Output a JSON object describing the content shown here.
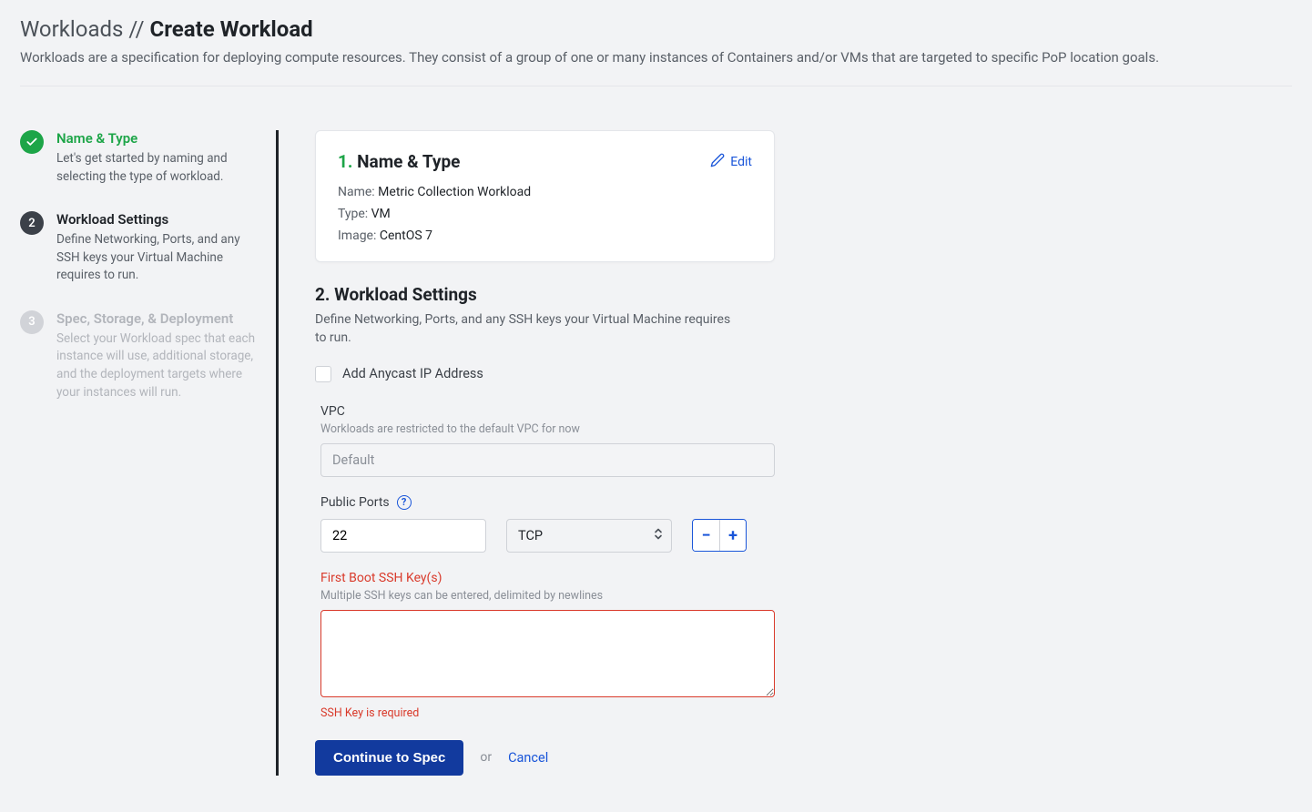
{
  "header": {
    "breadcrumb_prefix": "Workloads // ",
    "title": "Create Workload",
    "description": "Workloads are a specification for deploying compute resources. They consist of a group of one or many instances of Containers and/or VMs that are targeted to specific PoP location goals."
  },
  "sidebar": {
    "steps": [
      {
        "title": "Name & Type",
        "desc": "Let's get started by naming and selecting the type of workload."
      },
      {
        "num": "2",
        "title": "Workload Settings",
        "desc": "Define Networking, Ports, and any SSH keys your Virtual Machine requires to run."
      },
      {
        "num": "3",
        "title": "Spec, Storage, & Deployment",
        "desc": "Select your Workload spec that each instance will use, additional storage, and the deployment targets where your instances will run."
      }
    ]
  },
  "summary": {
    "heading_num": "1. ",
    "heading_text": "Name & Type",
    "edit_label": "Edit",
    "rows": {
      "name_k": "Name: ",
      "name_v": "Metric Collection Workload",
      "type_k": "Type: ",
      "type_v": "VM",
      "image_k": "Image: ",
      "image_v": "CentOS 7"
    }
  },
  "settings": {
    "heading": "2. Workload Settings",
    "desc": "Define Networking, Ports, and any SSH keys your Virtual Machine requires to run.",
    "anycast_label": "Add Anycast IP Address",
    "vpc": {
      "label": "VPC",
      "help": "Workloads are restricted to the default VPC for now",
      "value": "Default"
    },
    "ports": {
      "label": "Public Ports",
      "value": "22",
      "protocol": "TCP"
    },
    "ssh": {
      "label": "First Boot SSH Key(s)",
      "help": "Multiple SSH keys can be entered, delimited by newlines",
      "error": "SSH Key is required"
    }
  },
  "actions": {
    "primary": "Continue to Spec",
    "or": "or",
    "cancel": "Cancel"
  }
}
